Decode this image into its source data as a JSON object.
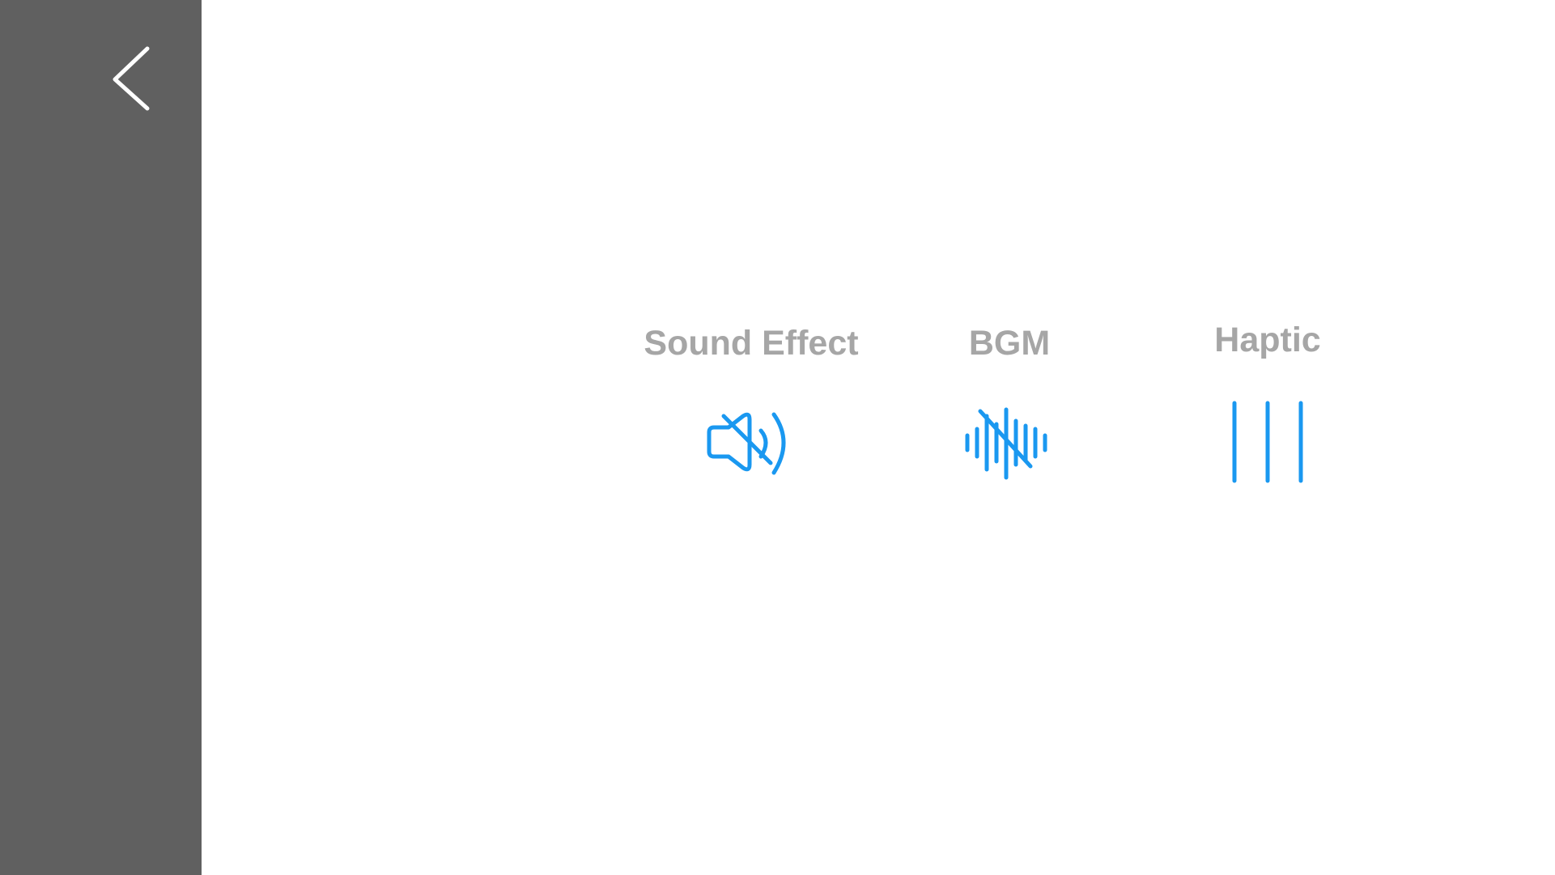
{
  "sidebar": {
    "back_icon": "chevron-left-icon",
    "background_color": "#606060"
  },
  "settings": [
    {
      "label": "Sound Effect",
      "icon": "speaker-muted-icon",
      "state": "off"
    },
    {
      "label": "BGM",
      "icon": "waveform-muted-icon",
      "state": "off"
    },
    {
      "label": "Haptic",
      "icon": "haptic-lines-icon",
      "state": "on"
    }
  ],
  "colors": {
    "accent": "#1a98f0",
    "label": "#a6a6a6",
    "background": "#ffffff"
  }
}
